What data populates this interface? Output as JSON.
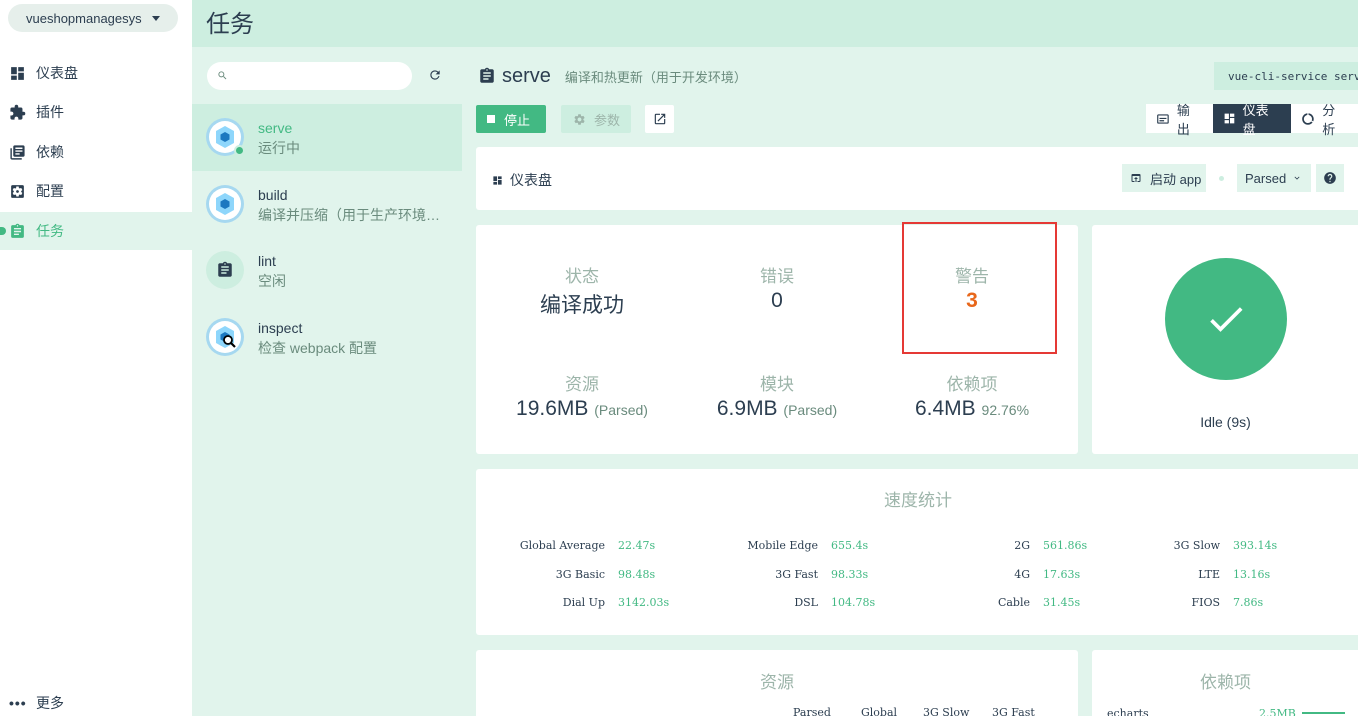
{
  "project": {
    "name": "vueshopmanagesys"
  },
  "nav": {
    "items": [
      {
        "label": "仪表盘",
        "icon": "dashboard-icon"
      },
      {
        "label": "插件",
        "icon": "puzzle-icon"
      },
      {
        "label": "依赖",
        "icon": "library-books-icon"
      },
      {
        "label": "配置",
        "icon": "settings-applications-icon"
      },
      {
        "label": "任务",
        "icon": "assignment-icon",
        "active": true
      }
    ],
    "more_label": "更多"
  },
  "header": {
    "title": "任务"
  },
  "tasklist": {
    "search_placeholder": "",
    "tasks": [
      {
        "name": "serve",
        "description": "运行中",
        "status": "running",
        "active": true
      },
      {
        "name": "build",
        "description": "编译并压缩（用于生产环境…"
      },
      {
        "name": "lint",
        "description": "空闲"
      },
      {
        "name": "inspect",
        "description": "检查 webpack 配置"
      }
    ]
  },
  "task": {
    "name": "serve",
    "description": "编译和热更新（用于开发环境）",
    "command": "vue-cli-service serve",
    "stop_label": "停止",
    "params_label": "参数",
    "view_tabs": {
      "output": "输出",
      "dashboard": "仪表盘",
      "analyzer": "分析"
    }
  },
  "dashboard": {
    "title": "仪表盘",
    "launch_label": "启动 app",
    "mode": "Parsed",
    "stats": {
      "status": {
        "label": "状态",
        "value": "编译成功"
      },
      "errors": {
        "label": "错误",
        "value": "0"
      },
      "warnings": {
        "label": "警告",
        "value": "3"
      },
      "assets": {
        "label": "资源",
        "value": "19.6MB",
        "unit": "(Parsed)"
      },
      "modules": {
        "label": "模块",
        "value": "6.9MB",
        "unit": "(Parsed)"
      },
      "deps": {
        "label": "依赖项",
        "value": "6.4MB",
        "unit": "92.76%"
      }
    },
    "idle_text": "Idle (9s)",
    "speed": {
      "title": "速度统计",
      "rows": [
        [
          {
            "label": "Global Average",
            "value": "22.47s"
          },
          {
            "label": "Mobile Edge",
            "value": "655.4s"
          },
          {
            "label": "2G",
            "value": "561.86s"
          },
          {
            "label": "3G Slow",
            "value": "393.14s"
          }
        ],
        [
          {
            "label": "3G Basic",
            "value": "98.48s"
          },
          {
            "label": "3G Fast",
            "value": "98.33s"
          },
          {
            "label": "4G",
            "value": "17.63s"
          },
          {
            "label": "LTE",
            "value": "13.16s"
          }
        ],
        [
          {
            "label": "Dial Up",
            "value": "3142.03s"
          },
          {
            "label": "DSL",
            "value": "104.78s"
          },
          {
            "label": "Cable",
            "value": "31.45s"
          },
          {
            "label": "FIOS",
            "value": "7.86s"
          }
        ]
      ]
    },
    "assets_panel": {
      "title": "资源",
      "headers": [
        "Parsed",
        "Global",
        "3G Slow",
        "3G Fast"
      ]
    },
    "deps_panel": {
      "title": "依赖项",
      "items": [
        {
          "name": "echarts",
          "size": "2.5MB"
        }
      ]
    }
  },
  "colors": {
    "accent": "#42b983",
    "warning": "#e8671b",
    "dark": "#2c3e50",
    "highlight": "#e53935"
  }
}
